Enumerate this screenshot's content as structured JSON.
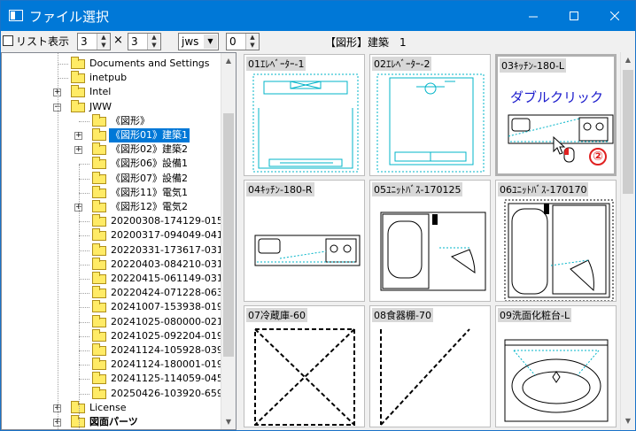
{
  "window": {
    "title": "ファイル選択",
    "minimize_glyph": "—",
    "maximize_glyph": "☐",
    "close_glyph": "✕"
  },
  "toolbar": {
    "list_view_label": "リスト表示",
    "list_view_checked": false,
    "cols_value": "3",
    "times_sign": "×",
    "rows_value": "3",
    "file_type": "jws",
    "num_value": "0",
    "current_folder": "【図形】建築　1"
  },
  "tree": {
    "items": [
      {
        "label": "Documents and Settings",
        "expander": ""
      },
      {
        "label": "inetpub",
        "expander": ""
      },
      {
        "label": "Intel",
        "expander": "+"
      },
      {
        "label": "JWW",
        "expander": "−"
      },
      {
        "label": "《図形》",
        "expander": ""
      },
      {
        "label": "《図形01》建築1",
        "expander": "+",
        "selected": true
      },
      {
        "label": "《図形02》建築2",
        "expander": "+"
      },
      {
        "label": "《図形06》設備1",
        "expander": ""
      },
      {
        "label": "《図形07》設備2",
        "expander": ""
      },
      {
        "label": "《図形11》電気1",
        "expander": ""
      },
      {
        "label": "《図形12》電気2",
        "expander": "+"
      },
      {
        "label": "20200308-174129-015",
        "expander": ""
      },
      {
        "label": "20200317-094049-041",
        "expander": ""
      },
      {
        "label": "20220331-173617-031",
        "expander": ""
      },
      {
        "label": "20220403-084210-031",
        "expander": ""
      },
      {
        "label": "20220415-061149-031",
        "expander": ""
      },
      {
        "label": "20220424-071228-063",
        "expander": ""
      },
      {
        "label": "20241007-153938-019",
        "expander": ""
      },
      {
        "label": "20241025-080000-021",
        "expander": ""
      },
      {
        "label": "20241025-092204-019",
        "expander": ""
      },
      {
        "label": "20241124-105928-039",
        "expander": ""
      },
      {
        "label": "20241124-180001-019",
        "expander": ""
      },
      {
        "label": "20241125-114059-045",
        "expander": ""
      },
      {
        "label": "20250426-103920-659",
        "expander": ""
      },
      {
        "label": "License",
        "expander": "+"
      },
      {
        "label": "図面パーツ",
        "expander": "+",
        "bold": true
      }
    ]
  },
  "thumbnails": [
    {
      "caption": "01ｴﾚﾍﾞｰﾀｰ-1"
    },
    {
      "caption": "02ｴﾚﾍﾞｰﾀｰ-2"
    },
    {
      "caption": "03ｷｯﾁﾝ-180-L"
    },
    {
      "caption": "04ｷｯﾁﾝ-180-R"
    },
    {
      "caption": "05ﾕﾆｯﾄﾊﾞｽ-170125"
    },
    {
      "caption": "06ﾕﾆｯﾄﾊﾞｽ-170170"
    },
    {
      "caption": "07冷蔵庫-60"
    },
    {
      "caption": "08食器棚-70"
    },
    {
      "caption": "09洗面化粧台-L"
    }
  ],
  "annotation": {
    "text": "ダブルクリック",
    "step_number": "②"
  },
  "colors": {
    "titlebar": "#0078d7",
    "selection": "#0078d7",
    "cad_line": "#00b4c8",
    "annotation": "#1c1ccc",
    "step_badge": "#e02020"
  }
}
